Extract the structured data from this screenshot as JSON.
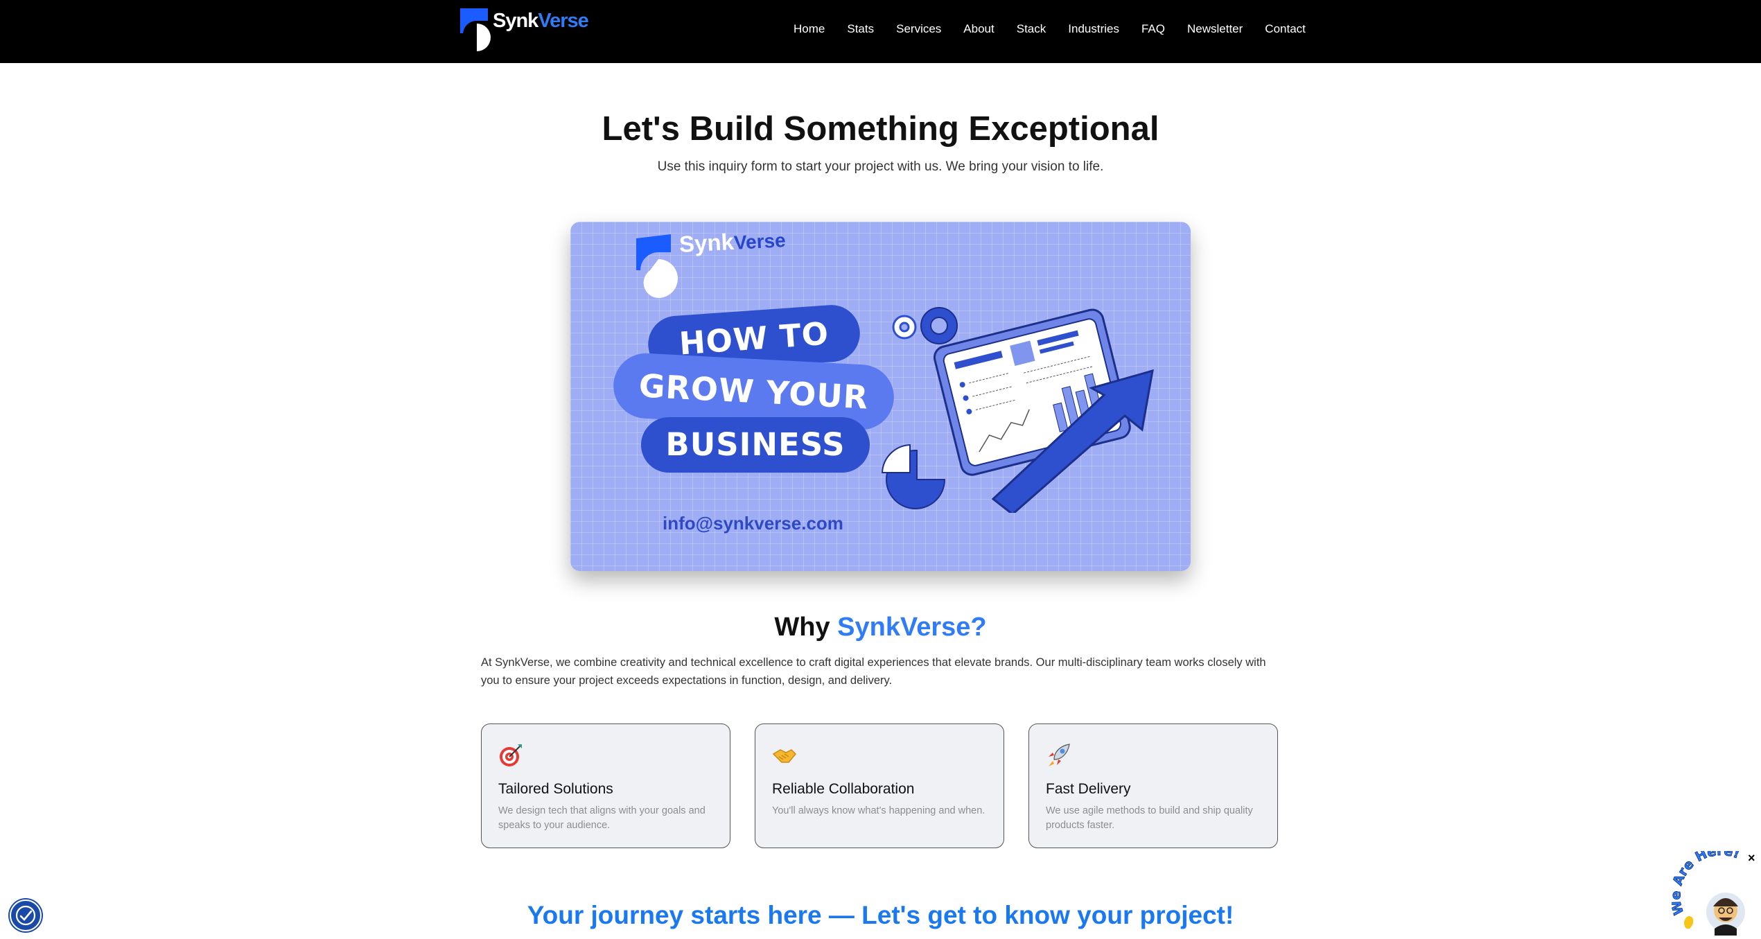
{
  "brand": {
    "name_part1": "Synk",
    "name_part2": "Verse",
    "accent": "#2f7cf6"
  },
  "nav": {
    "items": [
      "Home",
      "Stats",
      "Services",
      "About",
      "Stack",
      "Industries",
      "FAQ",
      "Newsletter",
      "Contact"
    ]
  },
  "hero": {
    "title": "Let's Build Something Exceptional",
    "subtitle": "Use this inquiry form to start your project with us. We bring your vision to life."
  },
  "banner": {
    "logo_part1": "Synk",
    "logo_part2": "Verse",
    "line1": "HOW TO",
    "line2": "GROW YOUR",
    "line3": "BUSINESS",
    "email": "info@synkverse.com",
    "background": "#9fadf5"
  },
  "why": {
    "title_prefix": "Why",
    "title_accent": "SynkVerse?",
    "text": "At SynkVerse, we combine creativity and technical excellence to craft digital experiences that elevate brands. Our multi-disciplinary team works closely with you to ensure your project exceeds expectations in function, design, and delivery.",
    "cards": [
      {
        "icon": "target-icon",
        "title": "Tailored Solutions",
        "desc": "We design tech that aligns with your goals and speaks to your audience."
      },
      {
        "icon": "handshake-icon",
        "title": "Reliable Collaboration",
        "desc": "You'll always know what's happening and when."
      },
      {
        "icon": "rocket-icon",
        "title": "Fast Delivery",
        "desc": "We use agile methods to build and ship quality products faster."
      }
    ]
  },
  "journey": {
    "title": "Your journey starts here — Let's get to know your project!"
  },
  "widget": {
    "text": "We Are Here!",
    "close": "×"
  }
}
